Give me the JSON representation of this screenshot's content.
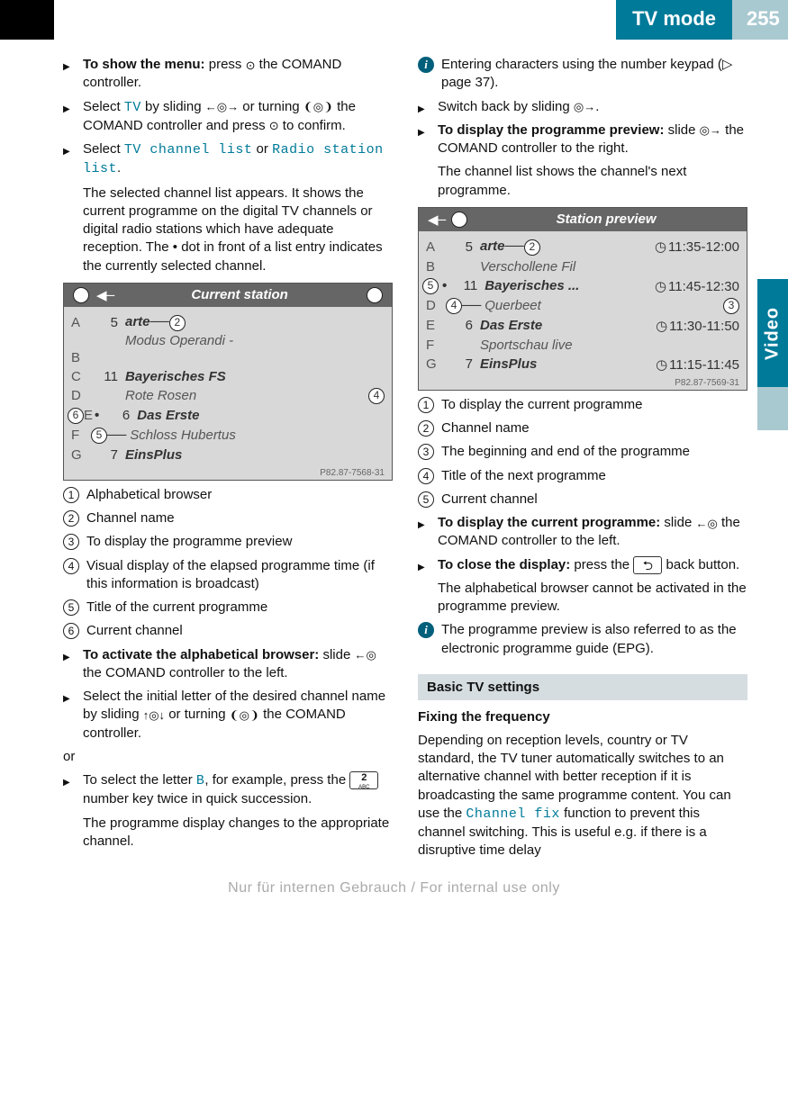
{
  "header": {
    "title": "TV mode",
    "page": "255"
  },
  "sidetab": "Video",
  "left": {
    "step1": {
      "body_a": "To show the menu:",
      "body_b": " press ",
      "body_c": " the COMAND controller."
    },
    "step2": {
      "a": "Select ",
      "tv": "TV",
      "b": " by sliding ",
      "c": " or turning ",
      "d": " the COMAND controller and press ",
      "e": " to confirm."
    },
    "step3": {
      "a": "Select ",
      "m1": "TV channel list",
      "or": " or ",
      "m2": "Radio sta­tion list",
      "dot": "."
    },
    "step3_cont": "The selected channel list appears. It shows the current programme on the digital TV channels or digital radio stations which have adequate reception. The • dot in front of a list entry indicates the currently selec­ted channel.",
    "fig1": {
      "title": "Current station",
      "rows": [
        {
          "lab": "A",
          "num": "5",
          "name": "arte",
          "sub": "Modus Operandi -"
        },
        {
          "lab": "B",
          "num": "",
          "name": ""
        },
        {
          "lab": "C",
          "num": "11",
          "name": "Bayerisches FS",
          "sub": "Rote Rosen"
        },
        {
          "lab": "D",
          "num": "",
          "name": ""
        },
        {
          "lab": "E",
          "num": "6",
          "name": "Das Erste",
          "sub": "Schloss Hubertus"
        },
        {
          "lab": "F",
          "num": "",
          "name": ""
        },
        {
          "lab": "G",
          "num": "7",
          "name": "EinsPlus"
        }
      ],
      "id": "P82.87-7568-31"
    },
    "legend1": [
      "Alphabetical browser",
      "Channel name",
      "To display the programme preview",
      "Visual display of the elapsed programme time (if this information is broadcast)",
      "Title of the current programme",
      "Current channel"
    ],
    "step4": {
      "bold": "To activate the alphabetical browser:",
      "rest": " slide ",
      "rest2": " the COMAND controller to the left."
    },
    "step5": {
      "a": "Select the initial letter of the desired chan­nel name by sliding ",
      "b": " or turning ",
      "c": " the COMAND controller."
    },
    "or": "or",
    "step6": {
      "a": "To select the letter ",
      "B": "B",
      "b": ", for example, press the ",
      "c": " number key twice in quick suc­cession."
    },
    "step6_cont": "The programme display changes to the appropriate channel."
  },
  "right": {
    "note1": {
      "a": "Entering characters using the number keypad (",
      "tri": "▷",
      "b": " page 37)."
    },
    "step1": {
      "a": "Switch back by sliding ",
      "b": "."
    },
    "step2": {
      "bold": "To display the programme preview:",
      "a": " slide ",
      "b": " the COMAND controller to the right."
    },
    "step2_cont": "The channel list shows the channel's next programme.",
    "fig2": {
      "title": "Station preview",
      "rows": [
        {
          "lab": "A",
          "num": "5",
          "name": "arte",
          "time": "11:35-12:00",
          "sub": "Verschollene Fil"
        },
        {
          "lab": "B"
        },
        {
          "lab": "",
          "num": "11",
          "name": "Bayerisches ...",
          "time": "11:45-12:30",
          "dot": true
        },
        {
          "lab": "D",
          "sub": "Querbeet"
        },
        {
          "lab": "E",
          "num": "6",
          "name": "Das Erste",
          "time": "11:30-11:50"
        },
        {
          "lab": "F",
          "sub": "Sportschau live"
        },
        {
          "lab": "G",
          "num": "7",
          "name": "EinsPlus",
          "time": "11:15-11:45"
        }
      ],
      "id": "P82.87-7569-31"
    },
    "legend2": [
      "To display the current programme",
      "Channel name",
      "The beginning and end of the programme",
      "Title of the next programme",
      "Current channel"
    ],
    "step3": {
      "bold": "To display the current programme:",
      "a": " slide ",
      "b": " the COMAND controller to the left."
    },
    "step4": {
      "bold": "To close the display:",
      "a": " press the ",
      "b": " back button."
    },
    "step4_cont": "The alphabetical browser cannot be activa­ted in the programme preview.",
    "note2": "The programme preview is also referred to as the electronic programme guide (EPG).",
    "section": "Basic TV settings",
    "subhead": "Fixing the frequency",
    "para_a": "Depending on reception levels, country or TV standard, the TV tuner automatically switches to an alternative channel with better recep­tion if it is broadcasting the same programme content. You can use the ",
    "para_menu": "Channel fix",
    "para_b": " func­tion to prevent this channel switching. This is useful e.g. if there is a disruptive time delay"
  },
  "watermark": "Nur für internen Gebrauch / For internal use only",
  "key2": {
    "top": "2",
    "bot": "ABC"
  }
}
